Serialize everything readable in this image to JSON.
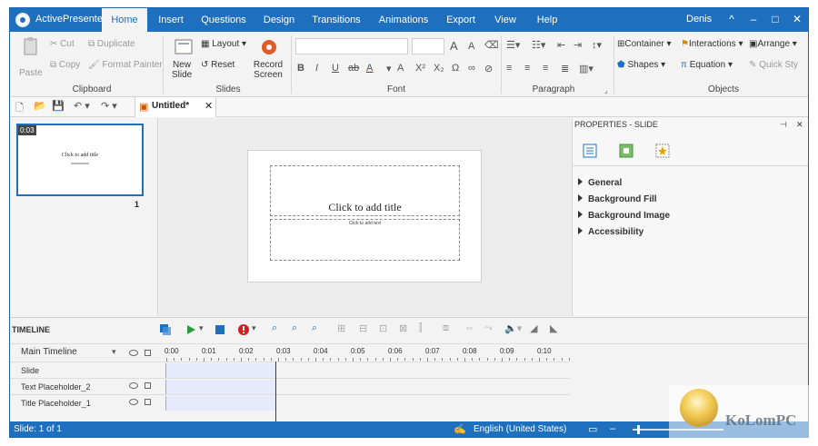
{
  "app": {
    "name": "ActivePresenter",
    "user": "Denis"
  },
  "tabs": [
    "Home",
    "Insert",
    "Questions",
    "Design",
    "Transitions",
    "Animations",
    "Export",
    "View",
    "Help"
  ],
  "ribbon": {
    "clipboard": {
      "paste": "Paste",
      "cut": "Cut",
      "copy": "Copy",
      "duplicate": "Duplicate",
      "format_painter": "Format Painter",
      "label": "Clipboard"
    },
    "slides": {
      "new_slide": "New",
      "new_slide_2": "Slide",
      "layout": "Layout",
      "reset": "Reset",
      "record": "Record",
      "record_2": "Screen",
      "label": "Slides"
    },
    "font": {
      "label": "Font"
    },
    "paragraph": {
      "label": "Paragraph"
    },
    "objects": {
      "container": "Container",
      "interactions": "Interactions",
      "arrange": "Arrange",
      "shapes": "Shapes",
      "equation": "Equation",
      "quick_style": "Quick Sty",
      "label": "Objects"
    }
  },
  "document": {
    "tab_title": "Untitled*"
  },
  "slides_panel": {
    "time": "0:03",
    "thumb_title": "Click to add title",
    "slide_number": "1"
  },
  "slide": {
    "title_placeholder": "Click to add title",
    "text_placeholder": "Click to add text"
  },
  "properties": {
    "header": "PROPERTIES - SLIDE",
    "sections": [
      "General",
      "Background Fill",
      "Background Image",
      "Accessibility"
    ]
  },
  "timeline": {
    "label": "TIMELINE",
    "main": "Main Timeline",
    "ticks": [
      "0:00",
      "0:01",
      "0:02",
      "0:03",
      "0:04",
      "0:05",
      "0:06",
      "0:07",
      "0:08",
      "0:09",
      "0:10"
    ],
    "tracks": [
      "Slide",
      "Text Placeholder_2",
      "Title Placeholder_1"
    ]
  },
  "status": {
    "slide_info": "Slide: 1 of 1",
    "language": "English (United States)"
  },
  "watermark": "KoLomPC",
  "colors": {
    "accent": "#1f6fbf",
    "playhead": "#cc0000",
    "clip": "#e6e9fb"
  }
}
